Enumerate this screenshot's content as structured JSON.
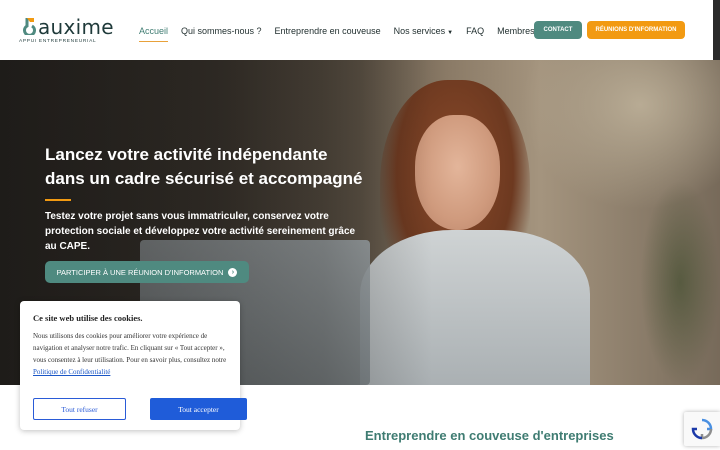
{
  "logo": {
    "name": "auxime",
    "tagline": "APPUI ENTREPRENEURIAL"
  },
  "nav": {
    "items": [
      {
        "label": "Accueil"
      },
      {
        "label": "Qui sommes-nous ?"
      },
      {
        "label": "Entreprendre en couveuse"
      },
      {
        "label": "Nos services"
      },
      {
        "label": "FAQ"
      },
      {
        "label": "Membres"
      }
    ],
    "active_index": 0
  },
  "header_buttons": {
    "contact": "CONTACT",
    "reunions": "RÉUNIONS D'INFORMATION"
  },
  "hero": {
    "title_line1": "Lancez votre activité indépendante",
    "title_line2": "dans un cadre sécurisé et accompagné",
    "subtitle": "Testez votre projet sans vous immatriculer, conservez votre protection sociale et développez votre activité sereinement grâce au CAPE.",
    "cta": "PARTICIPER À UNE RÉUNION D'INFORMATION"
  },
  "section": {
    "title": "Entreprendre en couveuse d'entreprises"
  },
  "cookie": {
    "title": "Ce site web utilise des cookies.",
    "text": "Nous utilisons des cookies pour améliorer votre expérience de navigation et analyser notre trafic. En cliquant sur « Tout accepter », vous consentez à leur utilisation. Pour en savoir plus, consultez notre",
    "link": "Politique de Confidentialité",
    "refuse": "Tout refuser",
    "accept": "Tout accepter"
  },
  "icons": {
    "cta_arrow": "arrow-right-circle-icon",
    "nav_caret": "chevron-down-icon",
    "recaptcha": "recaptcha-icon"
  },
  "colors": {
    "brand_green": "#4f8a80",
    "brand_orange": "#f29a12",
    "cookie_blue": "#1f5cd9"
  }
}
